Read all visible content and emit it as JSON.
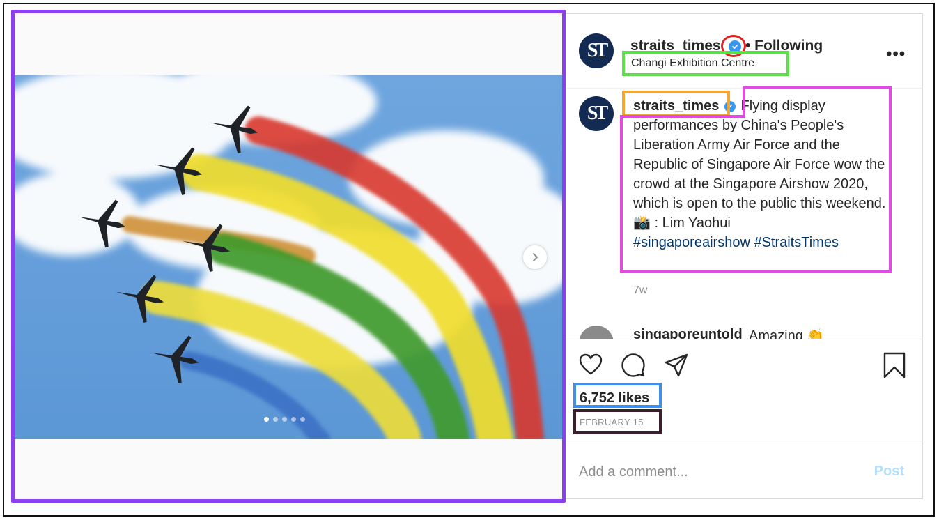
{
  "post": {
    "username": "straits_times",
    "follow_status": "• Following",
    "location": "Changi Exhibition Centre",
    "avatar_text": "ST",
    "more_label": "•••",
    "caption": {
      "username": "straits_times",
      "text": "Flying display performances by China's People's Liberation Army Air Force and the Republic of Singapore Air Force wow the crowd at the Singapore Airshow 2020, which is open to the public this weekend.",
      "credit": "📸 : Lim Yaohui",
      "hashtags": "#singaporeairshow #StraitsTimes"
    },
    "time_ago": "7w",
    "partial_comment": {
      "username": "singaporeuntold",
      "text": "Amazing 👏"
    },
    "likes": "6,752 likes",
    "date": "FEBRUARY 15",
    "comment_placeholder": "Add a comment...",
    "post_label": "Post"
  },
  "carousel": {
    "total_slides": 5,
    "current_slide": 1
  },
  "colors": {
    "verified": "#3897f0",
    "avatar_bg": "#132a52",
    "highlight_media": "#8a3ff2",
    "highlight_verified": "#e0231f",
    "highlight_location": "#5be04a",
    "highlight_username": "#f5a531",
    "highlight_caption": "#e04be0",
    "highlight_likes": "#3f8ee8",
    "highlight_date": "#3a1f2e"
  },
  "icons": [
    "heart-icon",
    "comment-icon",
    "share-icon",
    "bookmark-icon",
    "chevron-right-icon",
    "verified-badge-icon",
    "more-icon"
  ]
}
